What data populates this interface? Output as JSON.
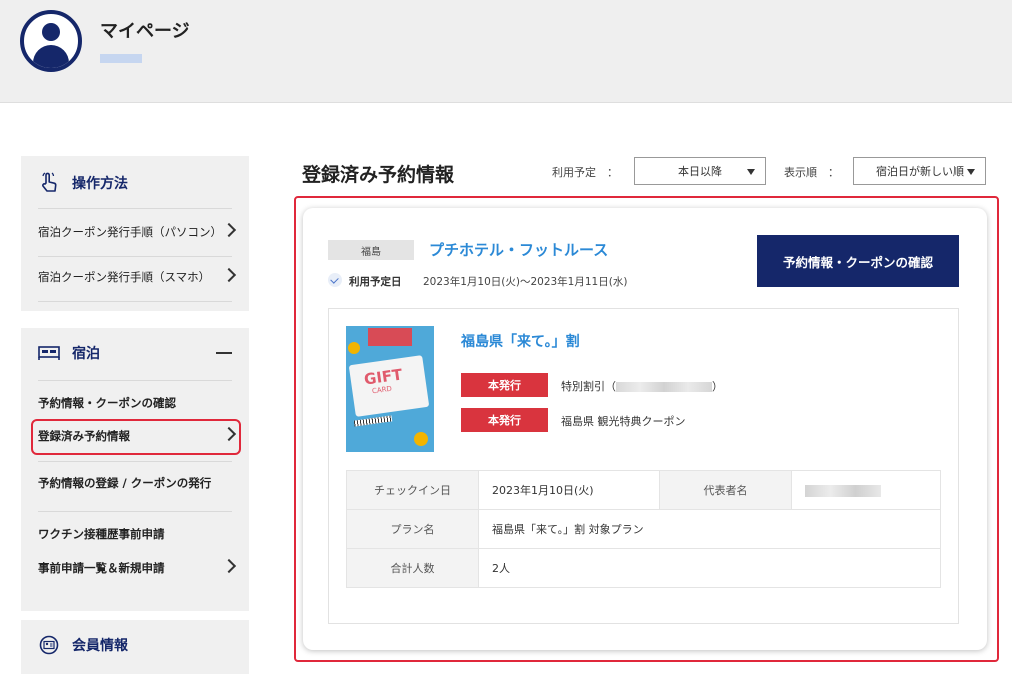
{
  "header": {
    "title": "マイページ"
  },
  "sidebar": {
    "howto": {
      "heading": "操作方法",
      "items": [
        {
          "label": "宿泊クーポン発行手順（パソコン）"
        },
        {
          "label": "宿泊クーポン発行手順（スマホ）"
        }
      ]
    },
    "stay": {
      "heading": "宿泊",
      "items": [
        {
          "label": "予約情報・クーポンの確認"
        },
        {
          "label": "登録済み予約情報"
        },
        {
          "label": "予約情報の登録 / クーポンの発行"
        },
        {
          "label": "ワクチン接種歴事前申請"
        },
        {
          "label": "事前申請一覧＆新規申請"
        }
      ]
    },
    "member": {
      "heading": "会員情報"
    }
  },
  "main": {
    "title": "登録済み予約情報",
    "filter_label": "利用予定　：",
    "filter_value": "本日以降",
    "sort_label": "表示順　：",
    "sort_value": "宿泊日が新しい順"
  },
  "reservation": {
    "prefecture": "福島",
    "hotel": "プチホテル・フットルース",
    "use_label": "利用予定日",
    "use_dates": "2023年1月10日(火)〜2023年1月11日(水)",
    "confirm_button": "予約情報・クーポンの確認",
    "thumb_text": "GIFT",
    "thumb_subtext": "CARD",
    "campaign": "福島県「来て。」割",
    "coupons": [
      {
        "status": "本発行",
        "text_prefix": "特別割引（",
        "text_suffix": "）"
      },
      {
        "status": "本発行",
        "text": "福島県 観光特典クーポン"
      }
    ],
    "table": {
      "checkin_label": "チェックイン日",
      "checkin_value": "2023年1月10日(火)",
      "rep_label": "代表者名",
      "plan_label": "プラン名",
      "plan_value": "福島県「来て。」割 対象プラン",
      "guests_label": "合計人数",
      "guests_value": "2人"
    }
  },
  "colors": {
    "navy": "#15276a",
    "link": "#2b89d6",
    "badge_red": "#d9343e",
    "highlight": "#e0283b"
  }
}
